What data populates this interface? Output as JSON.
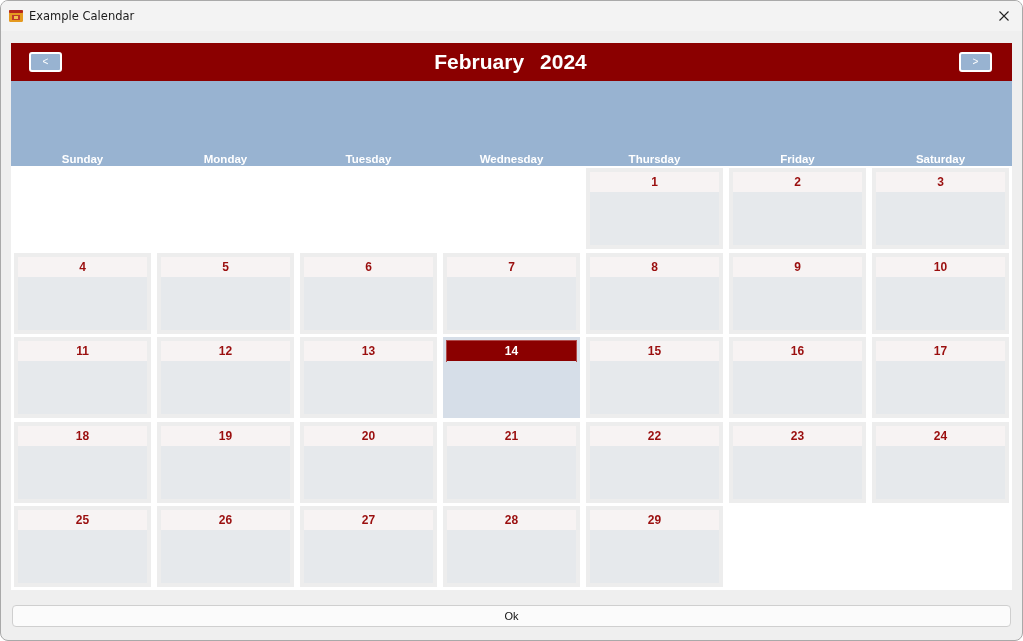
{
  "window": {
    "title": "Example Calendar"
  },
  "calendar": {
    "nav_prev": "<",
    "nav_next": ">",
    "month": "February",
    "year": "2024",
    "weekdays": [
      "Sunday",
      "Monday",
      "Tuesday",
      "Wednesday",
      "Thursday",
      "Friday",
      "Saturday"
    ],
    "weeks": [
      {
        "days": [
          {
            "kind": "empty"
          },
          {
            "kind": "empty"
          },
          {
            "kind": "empty"
          },
          {
            "kind": "empty"
          },
          {
            "kind": "day",
            "label": "1",
            "selected": false
          },
          {
            "kind": "day",
            "label": "2",
            "selected": false
          },
          {
            "kind": "day",
            "label": "3",
            "selected": false
          }
        ]
      },
      {
        "days": [
          {
            "kind": "day",
            "label": "4",
            "selected": false
          },
          {
            "kind": "day",
            "label": "5",
            "selected": false
          },
          {
            "kind": "day",
            "label": "6",
            "selected": false
          },
          {
            "kind": "day",
            "label": "7",
            "selected": false
          },
          {
            "kind": "day",
            "label": "8",
            "selected": false
          },
          {
            "kind": "day",
            "label": "9",
            "selected": false
          },
          {
            "kind": "day",
            "label": "10",
            "selected": false
          }
        ]
      },
      {
        "days": [
          {
            "kind": "day",
            "label": "11",
            "selected": false
          },
          {
            "kind": "day",
            "label": "12",
            "selected": false
          },
          {
            "kind": "day",
            "label": "13",
            "selected": false
          },
          {
            "kind": "day",
            "label": "14",
            "selected": true
          },
          {
            "kind": "day",
            "label": "15",
            "selected": false
          },
          {
            "kind": "day",
            "label": "16",
            "selected": false
          },
          {
            "kind": "day",
            "label": "17",
            "selected": false
          }
        ]
      },
      {
        "days": [
          {
            "kind": "day",
            "label": "18",
            "selected": false
          },
          {
            "kind": "day",
            "label": "19",
            "selected": false
          },
          {
            "kind": "day",
            "label": "20",
            "selected": false
          },
          {
            "kind": "day",
            "label": "21",
            "selected": false
          },
          {
            "kind": "day",
            "label": "22",
            "selected": false
          },
          {
            "kind": "day",
            "label": "23",
            "selected": false
          },
          {
            "kind": "day",
            "label": "24",
            "selected": false
          }
        ]
      },
      {
        "days": [
          {
            "kind": "day",
            "label": "25",
            "selected": false
          },
          {
            "kind": "day",
            "label": "26",
            "selected": false
          },
          {
            "kind": "day",
            "label": "27",
            "selected": false
          },
          {
            "kind": "day",
            "label": "28",
            "selected": false
          },
          {
            "kind": "day",
            "label": "29",
            "selected": false
          },
          {
            "kind": "empty"
          },
          {
            "kind": "empty"
          }
        ]
      }
    ]
  },
  "buttons": [
    {
      "label": "Ok"
    }
  ]
}
